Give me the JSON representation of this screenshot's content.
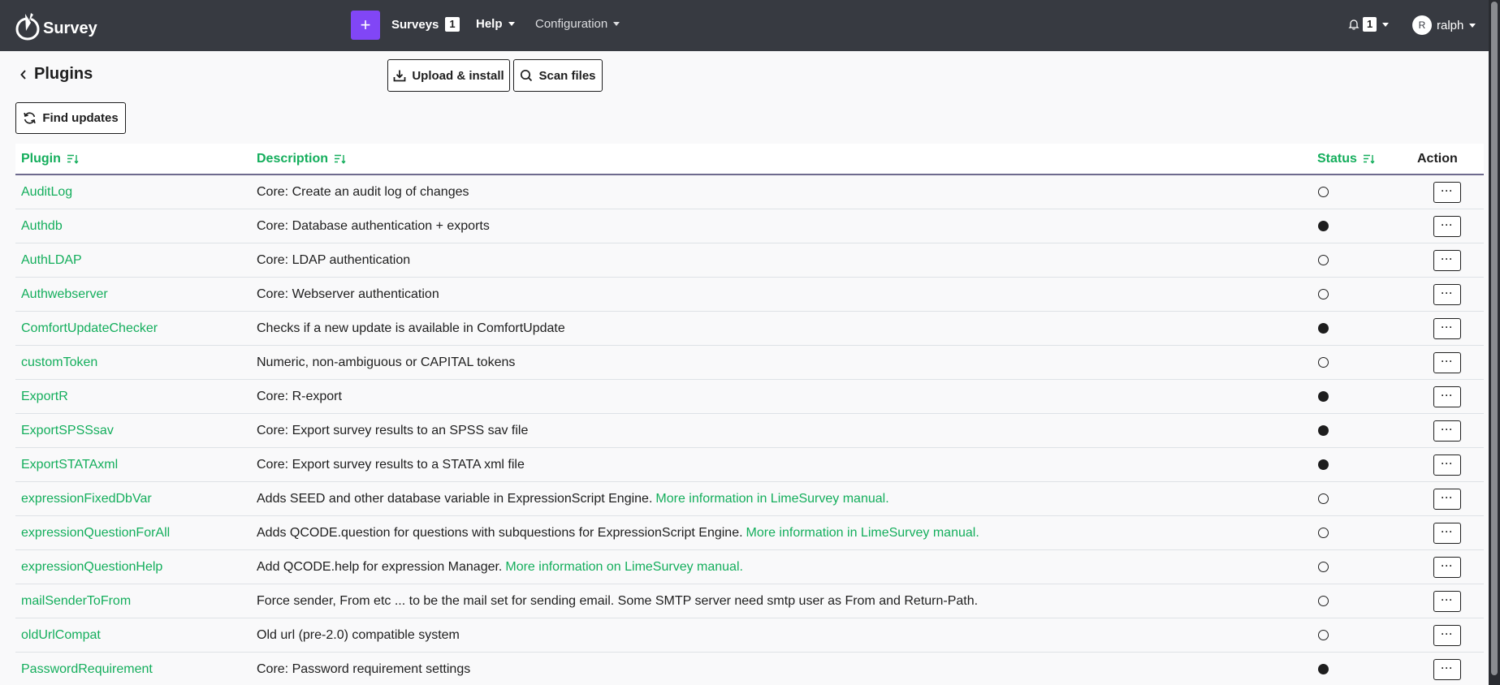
{
  "brand": {
    "name": "Survey"
  },
  "nav": {
    "plus_label": "+",
    "surveys_label": "Surveys",
    "surveys_count": "1",
    "help_label": "Help",
    "configuration_label": "Configuration",
    "notifications_count": "1",
    "user_initial": "R",
    "user_name": "ralph"
  },
  "page": {
    "title": "Plugins",
    "upload_label": "Upload & install",
    "scan_label": "Scan files",
    "find_updates_label": "Find updates"
  },
  "table": {
    "headers": {
      "plugin": "Plugin",
      "description": "Description",
      "status": "Status",
      "action": "Action"
    },
    "action_label": "···",
    "rows": [
      {
        "name": "AuditLog",
        "description": "Core: Create an audit log of changes",
        "link": "",
        "active": false
      },
      {
        "name": "Authdb",
        "description": "Core: Database authentication + exports",
        "link": "",
        "active": true
      },
      {
        "name": "AuthLDAP",
        "description": "Core: LDAP authentication",
        "link": "",
        "active": false
      },
      {
        "name": "Authwebserver",
        "description": "Core: Webserver authentication",
        "link": "",
        "active": false
      },
      {
        "name": "ComfortUpdateChecker",
        "description": "Checks if a new update is available in ComfortUpdate",
        "link": "",
        "active": true
      },
      {
        "name": "customToken",
        "description": "Numeric, non-ambiguous or CAPITAL tokens",
        "link": "",
        "active": false
      },
      {
        "name": "ExportR",
        "description": "Core: R-export",
        "link": "",
        "active": true
      },
      {
        "name": "ExportSPSSsav",
        "description": "Core: Export survey results to an SPSS sav file",
        "link": "",
        "active": true
      },
      {
        "name": "ExportSTATAxml",
        "description": "Core: Export survey results to a STATA xml file",
        "link": "",
        "active": true
      },
      {
        "name": "expressionFixedDbVar",
        "description": "Adds SEED and other database variable in ExpressionScript Engine.",
        "link": "More information in LimeSurvey manual.",
        "active": false
      },
      {
        "name": "expressionQuestionForAll",
        "description": "Adds QCODE.question for questions with subquestions for ExpressionScript Engine.",
        "link": "More information in LimeSurvey manual.",
        "active": false
      },
      {
        "name": "expressionQuestionHelp",
        "description": "Add QCODE.help for expression Manager.",
        "link": "More information on LimeSurvey manual.",
        "active": false
      },
      {
        "name": "mailSenderToFrom",
        "description": "Force sender, From etc ... to be the mail set for sending email. Some SMTP server need smtp user as From and Return-Path.",
        "link": "",
        "active": false
      },
      {
        "name": "oldUrlCompat",
        "description": "Old url (pre-2.0) compatible system",
        "link": "",
        "active": false
      },
      {
        "name": "PasswordRequirement",
        "description": "Core: Password requirement settings",
        "link": "",
        "active": true
      }
    ]
  },
  "colors": {
    "navbar": "#373a41",
    "accent": "#8146f6",
    "link": "#14ae5c"
  }
}
